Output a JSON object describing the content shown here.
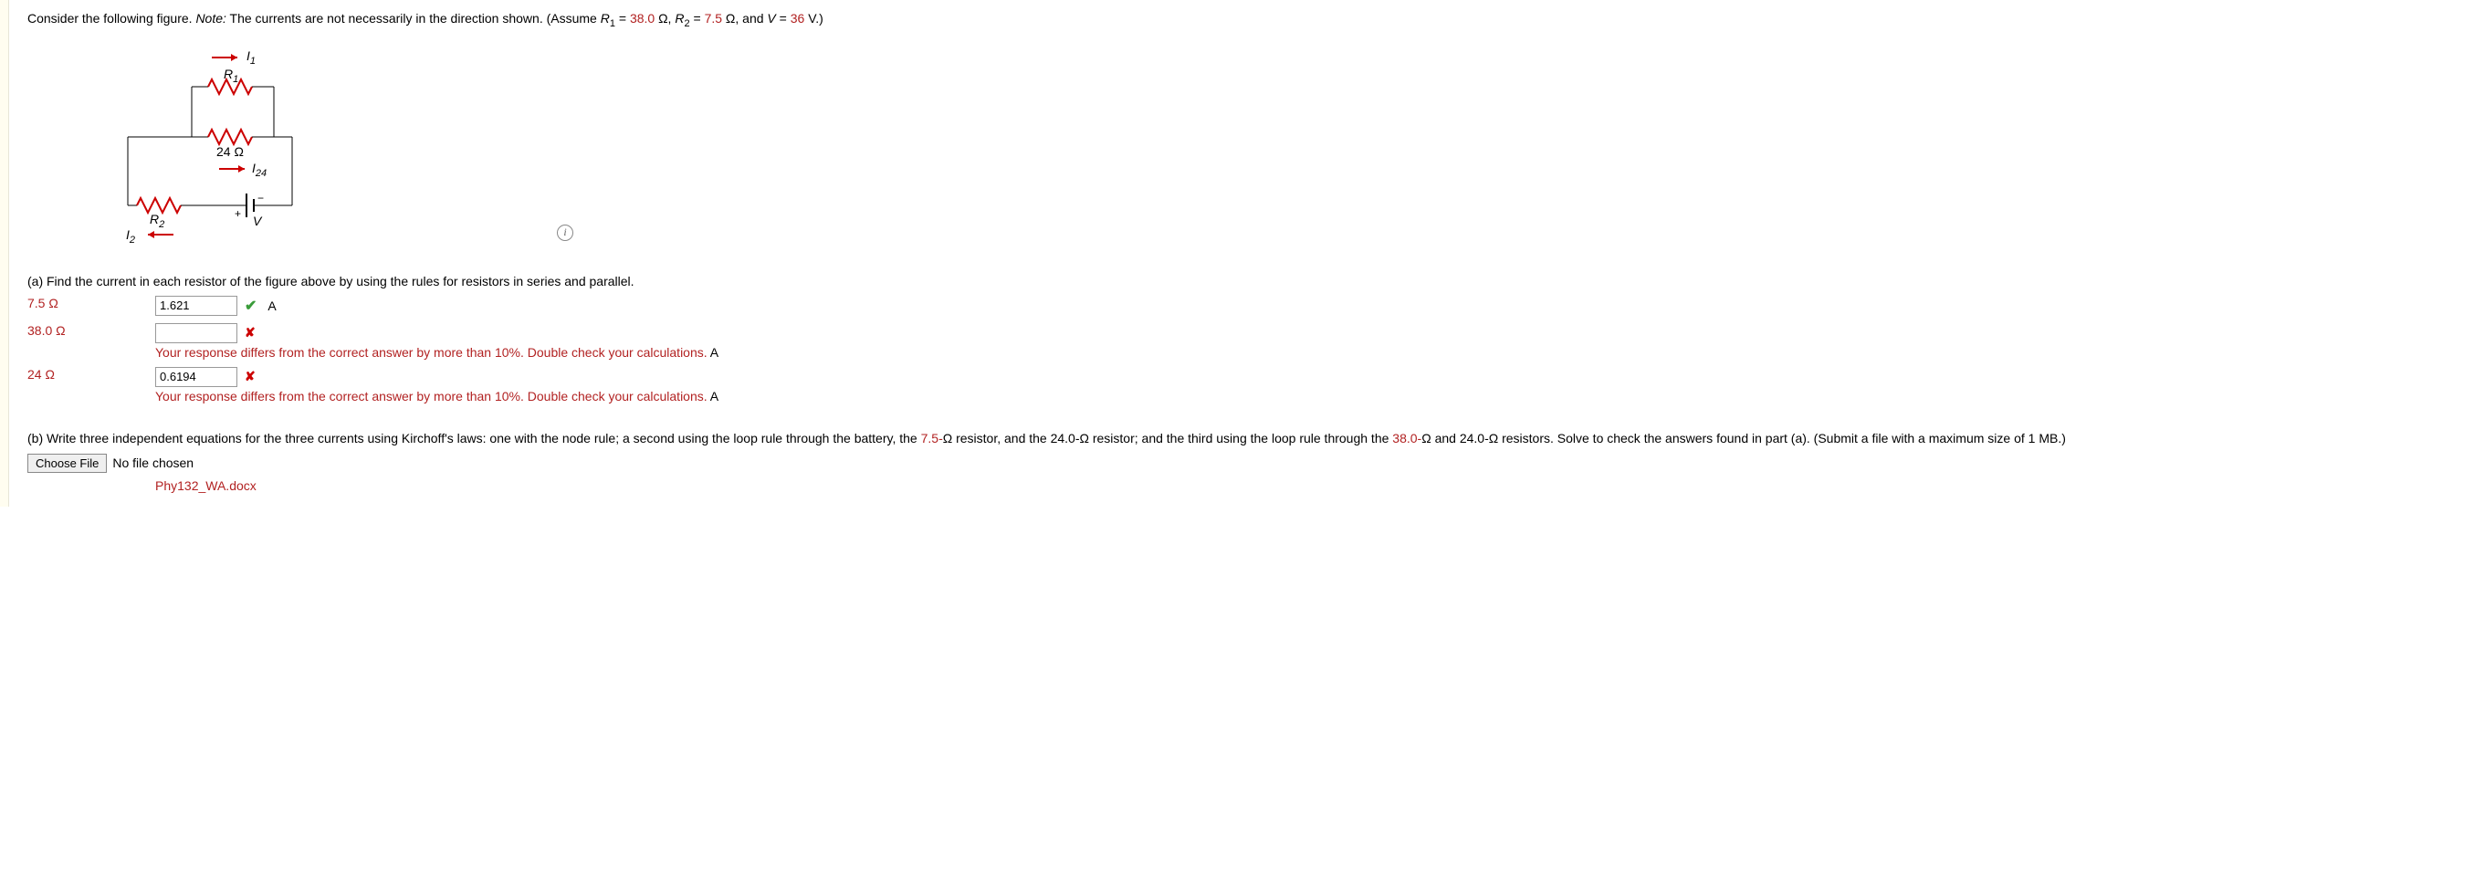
{
  "intro": {
    "prefix": "Consider the following figure. ",
    "note_label": "Note:",
    "middle": " The currents are not necessarily in the direction shown. (Assume ",
    "r1_sym": "R",
    "r1_sub": "1",
    "eq": " = ",
    "r1_val": "38.0",
    "ohm": " Ω, ",
    "r2_sym": "R",
    "r2_sub": "2",
    "r2_val": "7.5",
    "ohm2": " Ω, and ",
    "v_sym": "V",
    "v_val": "36",
    "v_unit": " V.)"
  },
  "circuit": {
    "I1": "I",
    "I1_sub": "1",
    "R1": "R",
    "R1_sub": "1",
    "R24": "24 Ω",
    "I24": "I",
    "I24_sub": "24",
    "R2": "R",
    "R2_sub": "2",
    "I2": "I",
    "I2_sub": "2",
    "V": "V",
    "plus": "+",
    "minus": "−"
  },
  "info": "i",
  "partA": {
    "label": "(a) Find the current in each resistor of the figure above by using the rules for resistors in series and parallel.",
    "rows": [
      {
        "label": "7.5 Ω",
        "value": "1.621",
        "status": "correct",
        "feedback": "",
        "unit": "A"
      },
      {
        "label": "38.0 Ω",
        "value": "",
        "status": "wrong",
        "feedback": "Your response differs from the correct answer by more than 10%. Double check your calculations.",
        "unit": "A"
      },
      {
        "label": "24 Ω",
        "value": "0.6194",
        "status": "wrong",
        "feedback": "Your response differs from the correct answer by more than 10%. Double check your calculations.",
        "unit": "A"
      }
    ]
  },
  "partB": {
    "text_before": "(b) Write three independent equations for the three currents using Kirchoff's laws: one with the node rule; a second using the loop rule through the battery, the ",
    "v1": "7.5-",
    "text_mid1": "Ω resistor, and the 24.0-Ω resistor; and the third using the loop rule through the ",
    "v2": "38.0-",
    "text_mid2": "Ω and 24.0-Ω resistors. Solve to check the answers found in part (a). (Submit a file with a maximum size of 1 MB.)",
    "choose_file": "Choose File",
    "no_file": "No file chosen",
    "uploaded": "Phy132_WA.docx"
  }
}
